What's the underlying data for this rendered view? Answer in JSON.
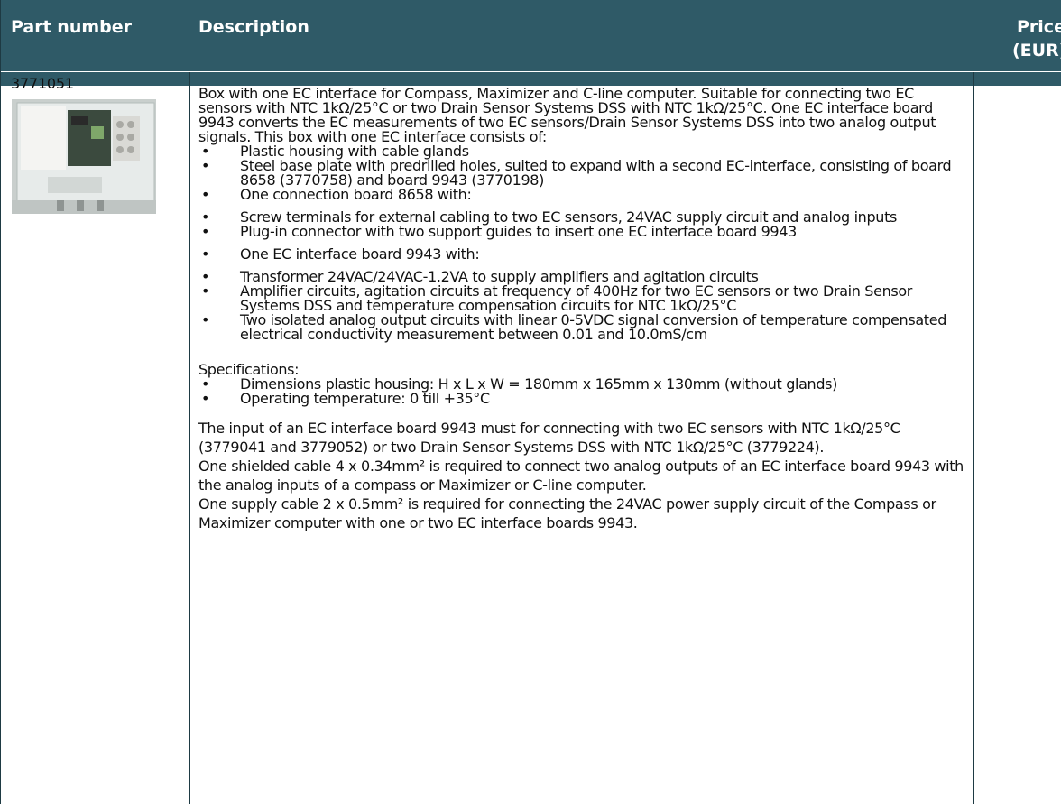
{
  "header": {
    "part_number": "Part number",
    "description": "Description",
    "price_line1": "Price",
    "price_line2": "(EUR)"
  },
  "row": {
    "part_number": "3771051",
    "intro": "Box with one EC interface for Compass, Maximizer and C-line computer. Suitable for connecting two EC sensors with NTC 1kΩ/25°C or two Drain Sensor Systems DSS with NTC 1kΩ/25°C. One EC interface board 9943 converts the EC measurements of two EC sensors/Drain Sensor Systems DSS into two analog output signals. This box with one EC interface consists of:",
    "items": [
      "Plastic housing with cable glands",
      "Steel base plate with predrilled holes, suited to expand with a second EC-interface, consisting of board 8658 (3770758) and board 9943 (3770198)",
      "One connection board 8658 with:"
    ],
    "board8658_sub": [
      "Screw terminals for external cabling to two EC sensors, 24VAC supply circuit and analog inputs",
      "Plug-in connector with two support guides to insert one EC interface board 9943"
    ],
    "item4": "One EC interface board 9943 with:",
    "board9943_sub": [
      "Transformer 24VAC/24VAC-1.2VA to supply amplifiers and agitation circuits",
      "Amplifier circuits, agitation circuits at frequency of 400Hz for two EC sensors or two Drain Sensor Systems DSS and temperature compensation circuits for NTC 1kΩ/25°C",
      "Two isolated analog output circuits with linear 0-5VDC signal conversion of temperature compensated electrical conductivity measurement between 0.01 and 10.0mS/cm"
    ],
    "specs_title": "Specifications:",
    "specs": [
      "Dimensions plastic housing: H x L x W = 180mm x 165mm x 130mm (without glands)",
      "Operating temperature: 0 till +35°C"
    ],
    "notes": [
      "The input of an EC interface board 9943 must for connecting with two EC sensors with NTC 1kΩ/25°C (3779041 and 3779052) or two Drain Sensor Systems DSS with NTC 1kΩ/25°C (3779224).",
      "One shielded cable 4 x 0.34mm² is required to connect two analog outputs of an EC interface board 9943 with the analog inputs of a compass or Maximizer or C-line computer.",
      "One supply cable 2 x 0.5mm² is required for connecting the 24VAC power supply circuit of the Compass or Maximizer computer with one or two EC interface boards 9943."
    ]
  },
  "colors": {
    "header_bg": "#2f5a67",
    "header_text": "#ffffff",
    "border": "#1e3a43"
  },
  "icons": {
    "photo": "product-photo-ec-interface-box"
  }
}
